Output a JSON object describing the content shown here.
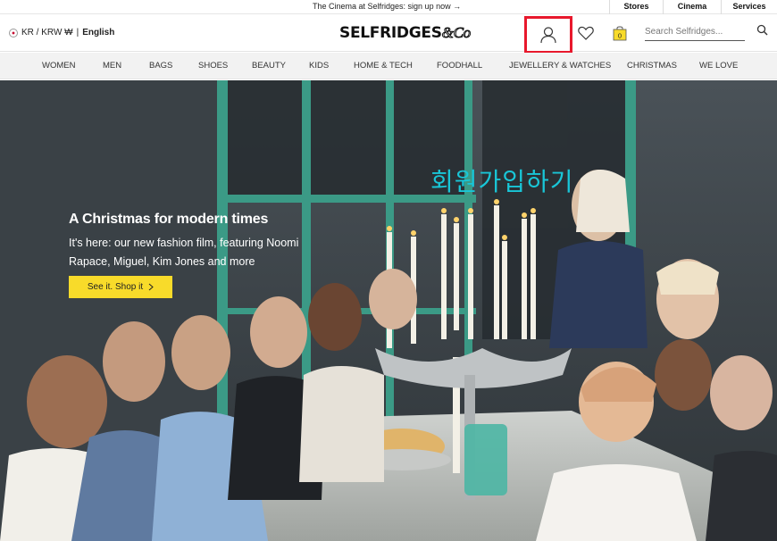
{
  "promo": {
    "text": "The Cinema at Selfridges: sign up now →",
    "links": [
      "Stores",
      "Cinema",
      "Services"
    ]
  },
  "header": {
    "locale": "KR / KRW ₩",
    "language": "English",
    "logo": "SELFRIDGES",
    "logo_suffix": "&Co",
    "bag_count": "0",
    "search_placeholder": "Search Selfridges..."
  },
  "nav": {
    "items": [
      "WOMEN",
      "MEN",
      "BAGS",
      "SHOES",
      "BEAUTY",
      "KIDS",
      "HOME & TECH",
      "FOODHALL",
      "JEWELLERY & WATCHES",
      "CHRISTMAS",
      "WE LOVE"
    ]
  },
  "hero": {
    "title": "A Christmas for modern times",
    "subtitle": "It's here: our new fashion film, featuring Noomi Rapace, Miguel, Kim Jones and more",
    "cta": "See it. Shop it",
    "annotation": "회원가입하기"
  },
  "colors": {
    "highlight": "#e8182c",
    "cta": "#f8db2a",
    "annotation": "#19c6d7",
    "hero_bg": "#3f474c",
    "window_frame": "#3b9a86"
  }
}
